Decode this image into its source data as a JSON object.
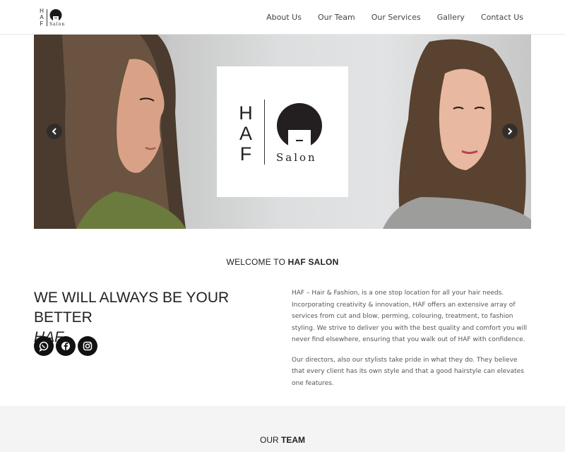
{
  "brand": {
    "letters": [
      "H",
      "A",
      "F"
    ],
    "sub": "Salon"
  },
  "nav": {
    "items": [
      "About Us",
      "Our Team",
      "Our Services",
      "Gallery",
      "Contact Us"
    ]
  },
  "hero": {
    "card_letters": [
      "H",
      "A",
      "F"
    ],
    "card_sub": "Salon",
    "prev_icon": "chevron-left-icon",
    "next_icon": "chevron-right-icon"
  },
  "welcome": {
    "prefix": "WELCOME TO ",
    "strong": "HAF SALON"
  },
  "tagline": {
    "line1": "WE WILL ALWAYS BE YOUR BETTER",
    "emph": "HAF",
    "end": "."
  },
  "social": {
    "icons": [
      "whatsapp-icon",
      "facebook-icon",
      "instagram-icon"
    ]
  },
  "about": {
    "paragraph1": "HAF – Hair & Fashion, is a one stop location for all your hair needs. Incorporating creativity & innovation, HAF offers an extensive array of services from cut and blow, perming, colouring, treatment, to fashion styling. We strive to deliver you with the best quality and comfort you will never find elsewhere, ensuring that you walk out of HAF with confidence.",
    "paragraph2": "Our directors, also our stylists take pride in what they do. They believe that every client has its own style and that a good hairstyle can elevates one features."
  },
  "team": {
    "prefix": "OUR ",
    "strong": "TEAM"
  },
  "colors": {
    "text": "#222222",
    "muted": "#555555",
    "band": "#f4f4f4",
    "dark": "#111111"
  }
}
